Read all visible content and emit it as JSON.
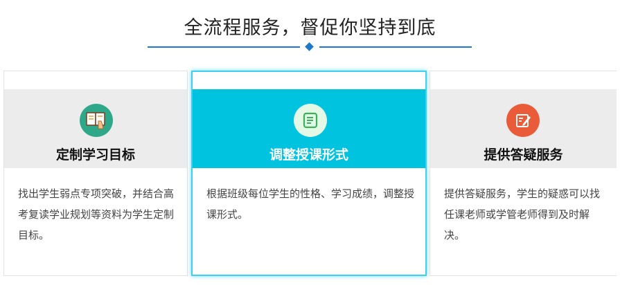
{
  "section_title": "全流程服务，督促你坚持到底",
  "colors": {
    "accent_blue": "#1e78c8",
    "highlight_cyan": "#00c3e0",
    "icon_green": "#2fa88a",
    "icon_orange": "#ea5b3a"
  },
  "cards": [
    {
      "icon": "book-hand-icon",
      "title": "定制学习目标",
      "text": "找出学生弱点专项突破，并结合高考复读学业规划等资料为学生定制目标。"
    },
    {
      "icon": "notebook-icon",
      "title": "调整授课形式",
      "text": "根据班级每位学生的性格、学习成绩，调整授课形式。"
    },
    {
      "icon": "edit-note-icon",
      "title": "提供答疑服务",
      "text": "提供答疑服务，学生的疑惑可以找任课老师或学管老师得到及时解决。"
    }
  ]
}
